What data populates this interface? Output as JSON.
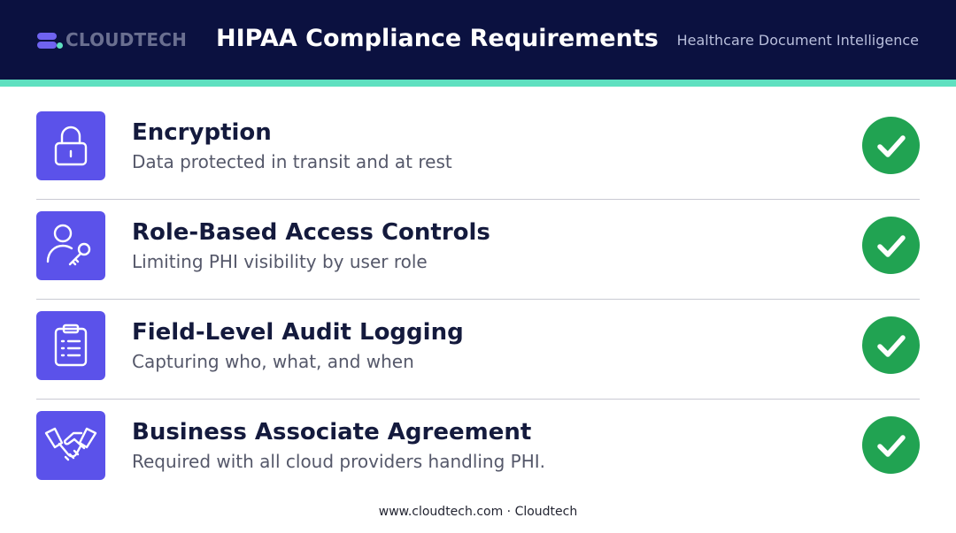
{
  "header": {
    "logo_text": "CLOUDTECH",
    "title": "HIPAA Compliance Requirements",
    "tagline": "Healthcare Document Intelligence"
  },
  "requirements": [
    {
      "title": "Encryption",
      "description": "Data protected in transit and at rest",
      "icon": "lock-icon",
      "status_icon": "check-circle-icon"
    },
    {
      "title": "Role-Based Access Controls",
      "description": "Limiting PHI visibility by user role",
      "icon": "user-key-icon",
      "status_icon": "check-circle-icon"
    },
    {
      "title": "Field-Level Audit Logging",
      "description": "Capturing who, what, and when",
      "icon": "clipboard-list-icon",
      "status_icon": "check-circle-icon"
    },
    {
      "title": "Business Associate Agreement",
      "description": "Required with all cloud providers handling PHI.",
      "icon": "handshake-icon",
      "status_icon": "check-circle-icon"
    }
  ],
  "footer": {
    "text": "www.cloudtech.com · Cloudtech"
  },
  "colors": {
    "header_bg": "#0b1140",
    "accent": "#5fe0c0",
    "icon_tile": "#5b52ea",
    "check": "#21a352",
    "title_text": "#141a3d",
    "body_text": "#55586a"
  }
}
